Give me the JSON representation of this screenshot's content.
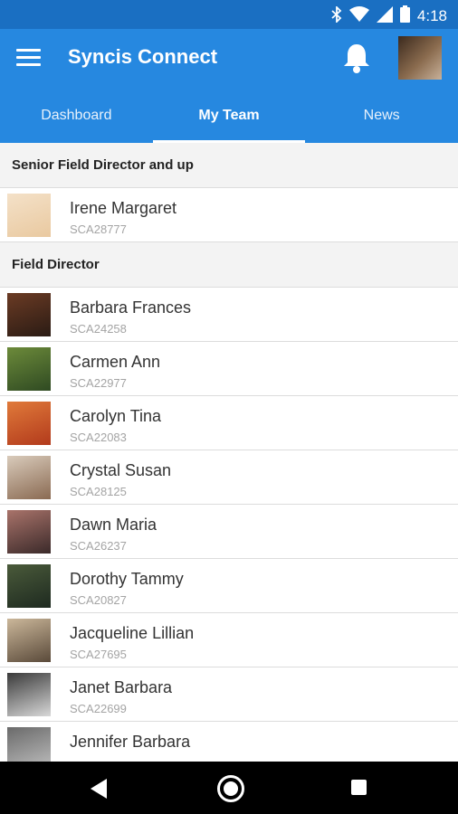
{
  "status": {
    "time": "4:18"
  },
  "app": {
    "title": "Syncis Connect"
  },
  "tabs": [
    {
      "label": "Dashboard",
      "active": false
    },
    {
      "label": "My Team",
      "active": true
    },
    {
      "label": "News",
      "active": false
    }
  ],
  "sections": [
    {
      "title": "Senior Field Director and up",
      "members": [
        {
          "name": "Irene Margaret",
          "code": "SCA28777",
          "avatar_colors": [
            "#e9c9a0",
            "#f4e1c8"
          ]
        }
      ]
    },
    {
      "title": "Field Director",
      "members": [
        {
          "name": "Barbara Frances",
          "code": "SCA24258",
          "avatar_colors": [
            "#2a1b14",
            "#6b3b24"
          ]
        },
        {
          "name": "Carmen Ann",
          "code": "SCA22977",
          "avatar_colors": [
            "#2f4a22",
            "#6c8a3a"
          ]
        },
        {
          "name": "Carolyn Tina",
          "code": "SCA22083",
          "avatar_colors": [
            "#b23a1c",
            "#e07a3a"
          ]
        },
        {
          "name": "Crystal Susan",
          "code": "SCA28125",
          "avatar_colors": [
            "#8a6a52",
            "#d9cbbb"
          ]
        },
        {
          "name": "Dawn Maria",
          "code": "SCA26237",
          "avatar_colors": [
            "#3b2a2a",
            "#a9736a"
          ]
        },
        {
          "name": "Dorothy Tammy",
          "code": "SCA20827",
          "avatar_colors": [
            "#1e2a20",
            "#4a5a3a"
          ]
        },
        {
          "name": "Jacqueline Lillian",
          "code": "SCA27695",
          "avatar_colors": [
            "#5a4a3a",
            "#cbb79a"
          ]
        },
        {
          "name": "Janet Barbara",
          "code": "SCA22699",
          "avatar_colors": [
            "#d8d8d8",
            "#3a3a3a"
          ]
        },
        {
          "name": "Jennifer Barbara",
          "code": "",
          "avatar_colors": [
            "#c0c0c0",
            "#6a6a6a"
          ]
        }
      ]
    }
  ],
  "colors": {
    "primary": "#2688e0",
    "status_bar": "#1a6fc2"
  }
}
